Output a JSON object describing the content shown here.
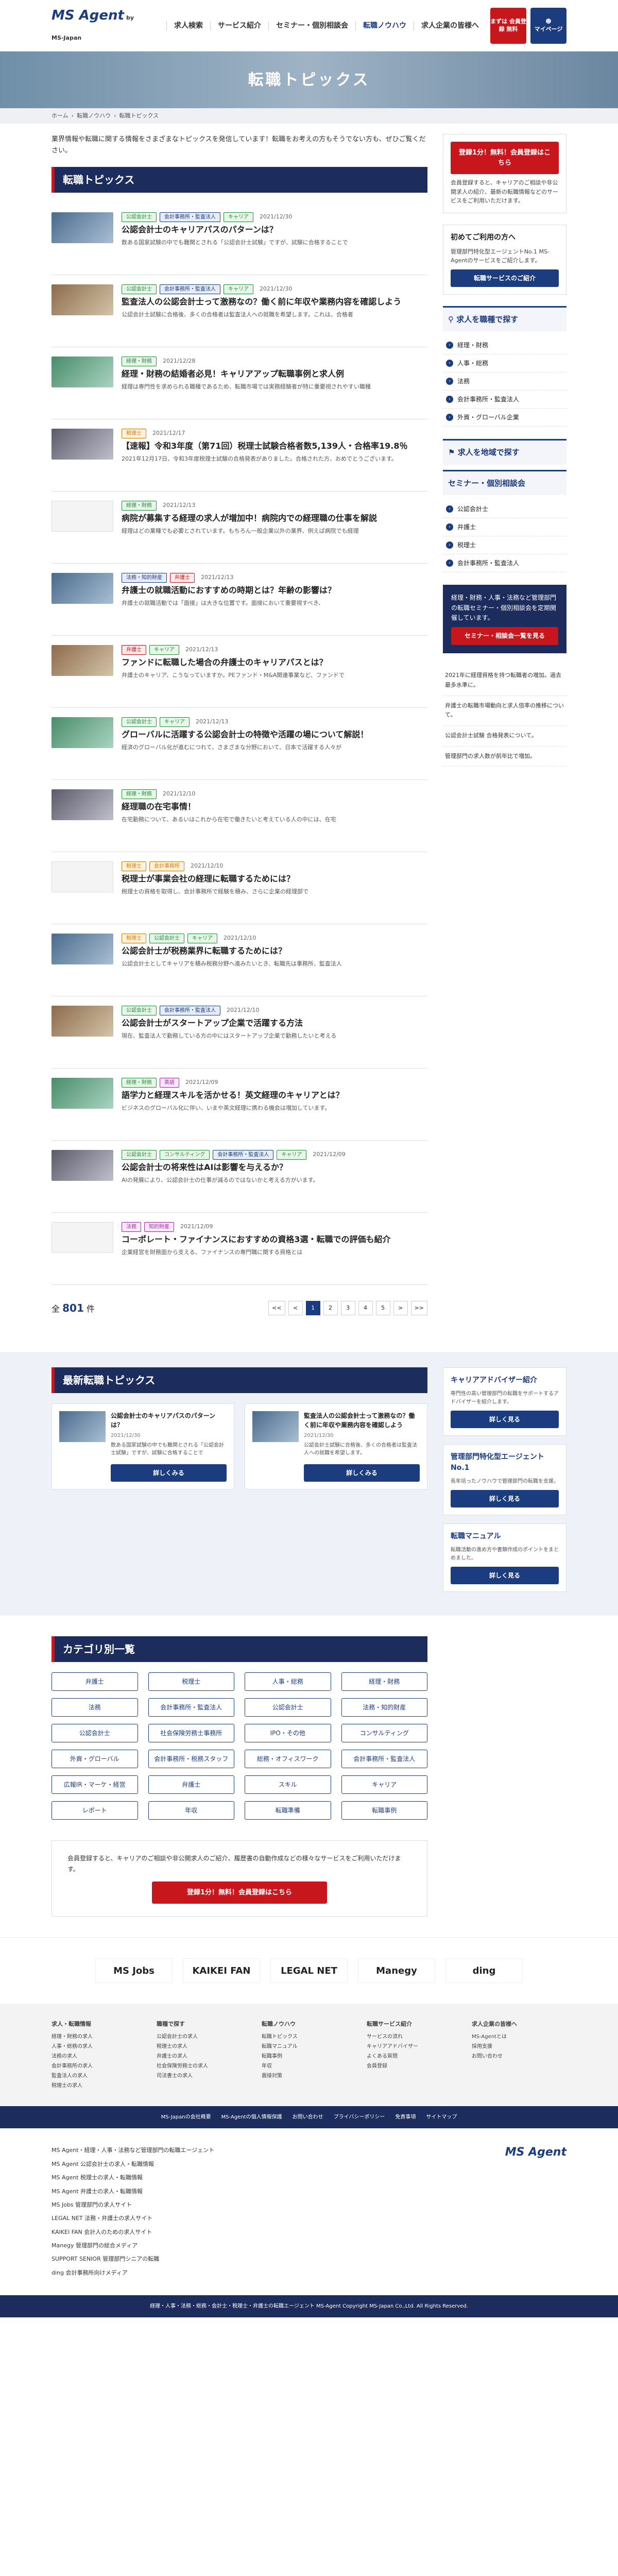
{
  "header": {
    "logo": "MS Agent",
    "logo_sub": "by MS-Japan",
    "nav": [
      "求人検索",
      "サービス紹介",
      "セミナー・個別相談会",
      "転職ノウハウ",
      "求人企業の皆様へ"
    ],
    "btn_register": "まずは 会員登録 無料",
    "btn_mypage": "マイページ"
  },
  "hero": {
    "title": "転職トピックス"
  },
  "breadcrumb": [
    "ホーム",
    "転職ノウハウ",
    "転職トピックス"
  ],
  "intro": "業界情報や転職に関する情報をさまざまなトピックスを発信しています！転職をお考えの方もそうでない方も、ぜひご覧ください。",
  "section_title": "転職トピックス",
  "articles": [
    {
      "tags": [
        [
          "公認会計士",
          "tg"
        ],
        [
          "会計事務所・監査法人",
          "tb"
        ],
        [
          "キャリア",
          "tg"
        ]
      ],
      "date": "2021/12/30",
      "title": "公認会計士のキャリアパスのパターンは？",
      "excerpt": "数ある国家試験の中でも難関とされる「公認会計士試験」ですが、試験に合格することで"
    },
    {
      "tags": [
        [
          "公認会計士",
          "tg"
        ],
        [
          "会計事務所・監査法人",
          "tb"
        ],
        [
          "キャリア",
          "tg"
        ]
      ],
      "date": "2021/12/30",
      "title": "監査法人の公認会計士って激務なの？働く前に年収や業務内容を確認しよう",
      "excerpt": "公認会計士試験に合格後、多くの合格者は監査法人への就職を希望します。これは、合格者"
    },
    {
      "tags": [
        [
          "経理・財務",
          "tg"
        ]
      ],
      "date": "2021/12/28",
      "title": "経理・財務の結婚者必見！キャリアアップ転職事例と求人例",
      "excerpt": "経理は専門性を求められる職種であるため、転職市場では実務経験者が特に重要視されやすい職種"
    },
    {
      "tags": [
        [
          "税理士",
          "to"
        ]
      ],
      "date": "2021/12/17",
      "title": "【速報】令和3年度（第71回）税理士試験合格者数5,139人・合格率19.8％",
      "excerpt": "2021年12月17日、令和3年度税理士試験の合格発表がありました。合格された方、おめでとうございます。"
    },
    {
      "tags": [
        [
          "経理・財務",
          "tg"
        ]
      ],
      "date": "2021/12/13",
      "title": "病院が募集する経理の求人が増加中！病院内での経理職の仕事を解説",
      "excerpt": "経理はどの業種でも必要とされています。もちろん一般企業以外の業界、例えば病院でも経理"
    },
    {
      "tags": [
        [
          "法務・知的財産",
          "tb"
        ],
        [
          "弁護士",
          "tr"
        ]
      ],
      "date": "2021/12/13",
      "title": "弁護士の就職活動におすすめの時期とは？年齢の影響は？",
      "excerpt": "弁護士の就職活動では「面接」は大きな位置です。面接において重要視すべき、"
    },
    {
      "tags": [
        [
          "弁護士",
          "tr"
        ],
        [
          "キャリア",
          "tg"
        ]
      ],
      "date": "2021/12/13",
      "title": "ファンドに転職した場合の弁護士のキャリアパスとは？",
      "excerpt": "弁護士のキャリア、こうなっていますか。PEファンド・M&A関連事業など、ファンドで"
    },
    {
      "tags": [
        [
          "公認会計士",
          "tg"
        ],
        [
          "キャリア",
          "tg"
        ]
      ],
      "date": "2021/12/13",
      "title": "グローバルに活躍する公認会計士の特徴や活躍の場について解説！",
      "excerpt": "経済のグローバル化が進むにつれて、さまざまな分野において、日本で活躍する人々が"
    },
    {
      "tags": [
        [
          "経理・財務",
          "tg"
        ]
      ],
      "date": "2021/12/10",
      "title": "経理職の在宅事情！",
      "excerpt": "在宅勤務について、あるいはこれから在宅で働きたいと考えている人の中には、在宅"
    },
    {
      "tags": [
        [
          "税理士",
          "to"
        ],
        [
          "会計事務所",
          "to"
        ]
      ],
      "date": "2021/12/10",
      "title": "税理士が事業会社の経理に転職するためには？",
      "excerpt": "税理士の資格を取得し、会計事務所で経験を積み、さらに企業の経理部で"
    },
    {
      "tags": [
        [
          "税理士",
          "to"
        ],
        [
          "公認会計士",
          "tg"
        ],
        [
          "キャリア",
          "tg"
        ]
      ],
      "date": "2021/12/10",
      "title": "公認会計士が税務業界に転職するためには？",
      "excerpt": "公認会計士としてキャリアを積み税務分野へ進みたいとき、転職先は事務所、監査法人"
    },
    {
      "tags": [
        [
          "公認会計士",
          "tg"
        ],
        [
          "会計事務所・監査法人",
          "tb"
        ]
      ],
      "date": "2021/12/10",
      "title": "公認会計士がスタートアップ企業で活躍する方法",
      "excerpt": "現在、監査法人で勤務している方の中にはスタートアップ企業で勤務したいと考える"
    },
    {
      "tags": [
        [
          "経理・財務",
          "tg"
        ],
        [
          "英語",
          "tp"
        ]
      ],
      "date": "2021/12/09",
      "title": "語学力と経理スキルを活かせる！英文経理のキャリアとは？",
      "excerpt": "ビジネスのグローバル化に伴い、いまや英文経理に携わる機会は増加しています。"
    },
    {
      "tags": [
        [
          "公認会計士",
          "tg"
        ],
        [
          "コンサルティング",
          "tg"
        ],
        [
          "会計事務所・監査法人",
          "tb"
        ],
        [
          "キャリア",
          "tg"
        ]
      ],
      "date": "2021/12/09",
      "title": "公認会計士の将来性はAIは影響を与えるか？",
      "excerpt": "AIの発展により、公認会計士の仕事が減るのではないかと考える方がいます。"
    },
    {
      "tags": [
        [
          "法務",
          "tp"
        ],
        [
          "知的財産",
          "tp"
        ]
      ],
      "date": "2021/12/09",
      "title": "コーポレート・ファイナンスにおすすめの資格3選・転職での評価も紹介",
      "excerpt": "企業経営を財務面から支える、ファイナンスの専門職に関する資格とは"
    }
  ],
  "pager": {
    "total_label": "全",
    "total": "801",
    "unit": "件",
    "pages": [
      "<<",
      "<",
      "1",
      "2",
      "3",
      "4",
      "5",
      ">",
      ">>"
    ]
  },
  "side": {
    "reg_btn": "登録1分！無料！会員登録はこちら",
    "reg_text": "会員登録すると、キャリアのご相談や非公開求人の紹介、最新の転職情報などのサービスをご利用いただけます。",
    "first_title": "初めてご利用の方へ",
    "first_text": "管理部門特化型エージェントNo.1 MS-Agentのサービスをご紹介します。",
    "first_btn": "転職サービスのご紹介",
    "job_title": "求人を職種で探す",
    "jobs": [
      "経理・財務",
      "人事・総務",
      "法務",
      "会計事務所・監査法人",
      "外資・グローバル企業"
    ],
    "area_title": "求人を地域で探す",
    "seminar_title": "セミナー・個別相談会",
    "seminars": [
      "公認会計士",
      "弁護士",
      "税理士",
      "会計事務所・監査法人"
    ],
    "banner_text": "経理・財務・人事・法務など管理部門の転職セミナー・個別相談会を定期開催しています。",
    "banner_btn": "セミナー・相談会一覧を見る",
    "notes": [
      "2021年に経理資格を持つ転職者の増加。過去最多水準に。",
      "弁護士の転職市場動向と求人倍率の推移について。",
      "公認会計士試験 合格発表について。",
      "管理部門の求人数が前年比で増加。"
    ]
  },
  "latest": {
    "title": "最新転職トピックス",
    "cards": [
      {
        "title": "公認会計士のキャリアパスのパターンは？",
        "date": "2021/12/30",
        "excerpt": "数ある国家試験の中でも難関とされる「公認会計士試験」ですが、試験に合格することで",
        "btn": "詳しくみる"
      },
      {
        "title": "監査法人の公認会計士って激務なの？働く前に年収や業務内容を確認しよう",
        "date": "2021/12/30",
        "excerpt": "公認会計士試験に合格後、多くの合格者は監査法人への就職を希望します。",
        "btn": "詳しくみる"
      }
    ],
    "side_cards": [
      {
        "title": "キャリアアドバイザー紹介",
        "text": "専門性の高い管理部門の転職をサポートするアドバイザーを紹介します。",
        "btn": "詳しく見る"
      },
      {
        "title": "管理部門特化型エージェントNo.1",
        "text": "長年培ったノウハウで管理部門の転職を支援。",
        "btn": "詳しく見る"
      },
      {
        "title": "転職マニュアル",
        "text": "転職活動の進め方や書類作成のポイントをまとめました。",
        "btn": "詳しく見る"
      }
    ]
  },
  "category": {
    "title": "カテゴリ別一覧",
    "items": [
      "弁護士",
      "税理士",
      "人事・総務",
      "経理・財務",
      "法務",
      "会計事務所・監査法人",
      "公認会計士",
      "法務・知的財産",
      "公認会計士",
      "社会保険労務士事務所",
      "IPO・その他",
      "コンサルティング",
      "外資・グローバル",
      "会計事務所・税務スタッフ",
      "総務・オフィスワーク",
      "会計事務所・監査法人",
      "広報IR・マーケ・経営",
      "弁護士",
      "スキル",
      "キャリア",
      "レポート",
      "年収",
      "転職準備",
      "転職事例"
    ]
  },
  "cta": {
    "text": "会員登録すると、キャリアのご相談や非公開求人のご紹介、履歴書の自動作成などの様々なサービスをご利用いただけます。",
    "btn": "登録1分！無料！会員登録はこちら"
  },
  "brands": [
    "MS Jobs",
    "KAIKEI FAN",
    "LEGAL NET",
    "Manegy",
    "ding"
  ],
  "footer_map": [
    {
      "title": "求人・転職情報",
      "items": [
        "経理・財務の求人",
        "人事・総務の求人",
        "法務の求人",
        "会計事務所の求人",
        "監査法人の求人",
        "税理士の求人"
      ]
    },
    {
      "title": "職種で探す",
      "items": [
        "公認会計士の求人",
        "税理士の求人",
        "弁護士の求人",
        "社会保険労務士の求人",
        "司法書士の求人"
      ]
    },
    {
      "title": "転職ノウハウ",
      "items": [
        "転職トピックス",
        "転職マニュアル",
        "転職事例",
        "年収",
        "面接対策"
      ]
    },
    {
      "title": "転職サービス紹介",
      "items": [
        "サービスの流れ",
        "キャリアアドバイザー",
        "よくある質問",
        "会員登録"
      ]
    },
    {
      "title": "求人企業の皆様へ",
      "items": [
        "MS-Agentとは",
        "採用支援",
        "お問い合わせ"
      ]
    }
  ],
  "footer_bar": [
    "MS-Japanの会社概要",
    "MS-Agentの個人情報保護",
    "お問い合わせ",
    "プライバシーポリシー",
    "免責事項",
    "サイトマップ"
  ],
  "footer_links": [
    "MS Agent・経理・人事・法務など管理部門の転職エージェント",
    "MS Agent 公認会計士の求人・転職情報",
    "MS Agent 税理士の求人・転職情報",
    "MS Agent 弁護士の求人・転職情報",
    "MS Jobs 管理部門の求人サイト",
    "LEGAL NET 法務・弁護士の求人サイト",
    "KAIKEI FAN 会計人のための求人サイト",
    "Manegy 管理部門の総合メディア",
    "SUPPORT SENIOR 管理部門シニアの転職",
    "ding 会計事務所向けメディア"
  ],
  "copyright": "経理・人事・法務・総務・会計士・税理士・弁護士の転職エージェント MS-Agent Copyright MS-Japan Co.,Ltd. All Rights Reserved."
}
